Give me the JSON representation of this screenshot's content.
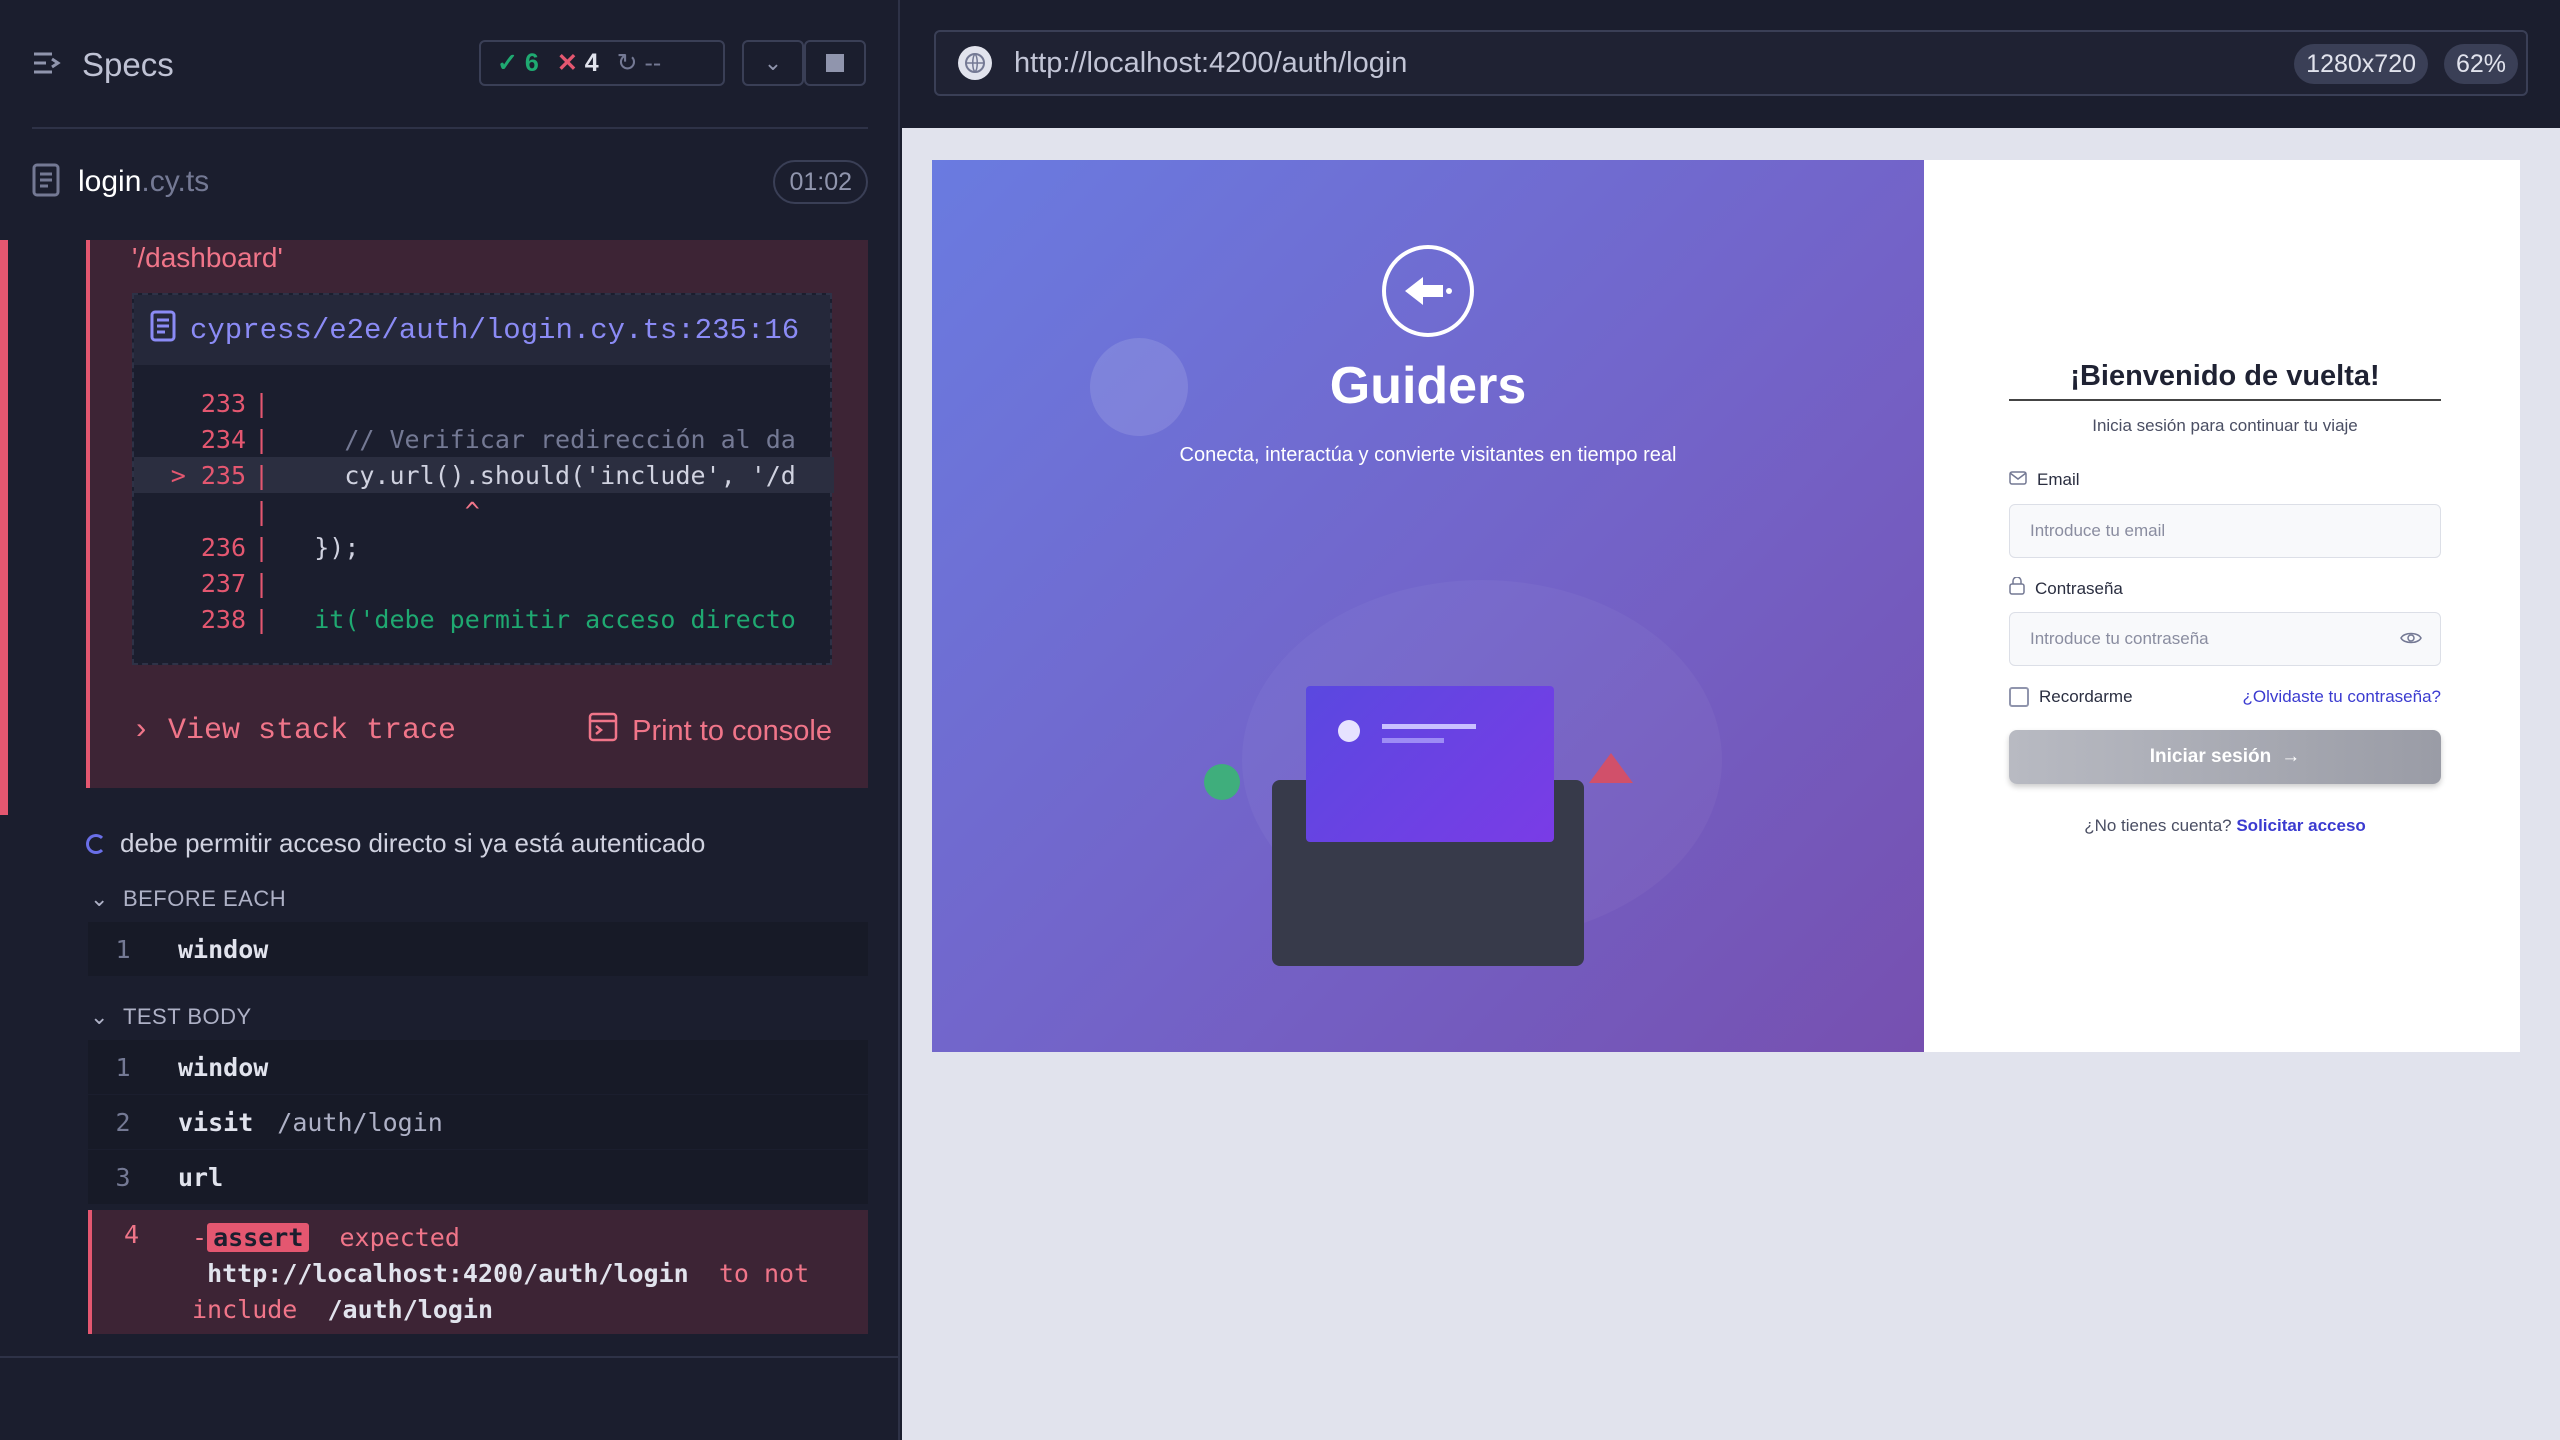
{
  "runner": {
    "specs_label": "Specs",
    "passed": "6",
    "failed": "4",
    "pending": "--",
    "file_name": "login",
    "file_ext": ".cy.ts",
    "timer": "01:02"
  },
  "error": {
    "message_tail": "'/dashboard'",
    "file_link": "cypress/e2e/auth/login.cy.ts:235:16",
    "code_lines": [
      {
        "num": "233",
        "code": ""
      },
      {
        "num": "234",
        "code": "    // Verificar redirección al da"
      },
      {
        "num": "> 235",
        "code": "    cy.url().should('include', '/d"
      },
      {
        "num": "",
        "code": "            ^"
      },
      {
        "num": "236",
        "code": "  });"
      },
      {
        "num": "237",
        "code": ""
      },
      {
        "num": "238",
        "code": "  it('debe permitir acceso directo"
      }
    ],
    "view_stack": "View stack trace",
    "print_console": "Print to console"
  },
  "test": {
    "title": "debe permitir acceso directo si ya está autenticado",
    "before_each_label": "BEFORE EACH",
    "before_each": [
      {
        "n": "1",
        "cmd": "window",
        "arg": ""
      }
    ],
    "test_body_label": "TEST BODY",
    "test_body": [
      {
        "n": "1",
        "cmd": "window",
        "arg": ""
      },
      {
        "n": "2",
        "cmd": "visit",
        "arg": "/auth/login"
      },
      {
        "n": "3",
        "cmd": "url",
        "arg": ""
      }
    ],
    "fail_num": "4",
    "fail_cmd": "assert",
    "fail_expected": "expected",
    "fail_url": "http://localhost:4200/auth/login",
    "fail_to_not": "to not",
    "fail_include": "include",
    "fail_path": "/auth/login"
  },
  "browser": {
    "url": "http://localhost:4200/auth/login",
    "viewport": "1280x720",
    "zoom": "62%"
  },
  "app": {
    "brand": "Guiders",
    "tagline": "Conecta, interactúa y convierte visitantes en tiempo real",
    "form_title": "¡Bienvenido de vuelta!",
    "form_subtitle": "Inicia sesión para continuar tu viaje",
    "email_label": "Email",
    "email_placeholder": "Introduce tu email",
    "password_label": "Contraseña",
    "password_placeholder": "Introduce tu contraseña",
    "remember": "Recordarme",
    "forgot": "¿Olvidaste tu contraseña?",
    "submit": "Iniciar sesión",
    "no_account": "¿No tienes cuenta?",
    "request_access": "Solicitar acceso"
  }
}
